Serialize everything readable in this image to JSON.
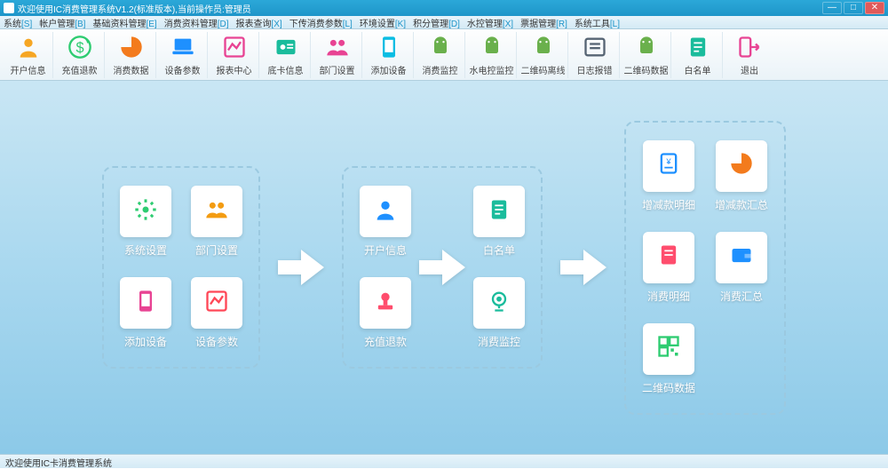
{
  "titlebar": {
    "title": "欢迎使用IC消费管理系统V1.2(标准版本),当前操作员:管理员"
  },
  "menus": [
    {
      "key": "S",
      "label": "系统"
    },
    {
      "key": "B",
      "label": "帐户管理"
    },
    {
      "key": "E",
      "label": "基础资料管理"
    },
    {
      "key": "D",
      "label": "消费资料管理"
    },
    {
      "key": "X",
      "label": "报表查询"
    },
    {
      "key": "L",
      "label": "下传消费参数"
    },
    {
      "key": "K",
      "label": "环境设置"
    },
    {
      "key": "D",
      "label": "积分管理"
    },
    {
      "key": "X",
      "label": "水控管理"
    },
    {
      "key": "R",
      "label": "票据管理"
    },
    {
      "key": "L",
      "label": "系统工具"
    }
  ],
  "toolbar": [
    {
      "name": "open-account-btn",
      "label": "开户信息",
      "color": "#f6a623",
      "icon": "user"
    },
    {
      "name": "recharge-btn",
      "label": "充值退款",
      "color": "#2ecc71",
      "icon": "dollar"
    },
    {
      "name": "consume-btn",
      "label": "消费数据",
      "color": "#f37b1d",
      "icon": "pie"
    },
    {
      "name": "device-param-btn",
      "label": "设备参数",
      "color": "#1e90ff",
      "icon": "laptop"
    },
    {
      "name": "report-btn",
      "label": "报表中心",
      "color": "#e84393",
      "icon": "chart"
    },
    {
      "name": "card-btn",
      "label": "底卡信息",
      "color": "#1abc9c",
      "icon": "id"
    },
    {
      "name": "dept-btn",
      "label": "部门设置",
      "color": "#e84393",
      "icon": "users"
    },
    {
      "name": "add-device-btn",
      "label": "添加设备",
      "color": "#0abde3",
      "icon": "device"
    },
    {
      "name": "consume-monitor-btn",
      "label": "消费监控",
      "color": "#6ab04c",
      "icon": "android"
    },
    {
      "name": "hydro-btn",
      "label": "水电控监控",
      "color": "#6ab04c",
      "icon": "android"
    },
    {
      "name": "qr-btn",
      "label": "二维码离线",
      "color": "#6ab04c",
      "icon": "android"
    },
    {
      "name": "log-btn",
      "label": "日志报错",
      "color": "#576574",
      "icon": "list"
    },
    {
      "name": "qr-data-btn",
      "label": "二维码数据",
      "color": "#6ab04c",
      "icon": "android"
    },
    {
      "name": "whitelist-btn",
      "label": "白名单",
      "color": "#1abc9c",
      "icon": "doc"
    },
    {
      "name": "exit-btn",
      "label": "退出",
      "color": "#e84393",
      "icon": "exit"
    }
  ],
  "groups": {
    "g1": [
      {
        "name": "sys-settings-card",
        "label": "系统设置",
        "color": "#2ecc71",
        "icon": "gear"
      },
      {
        "name": "dept-settings-card",
        "label": "部门设置",
        "color": "#f39c12",
        "icon": "users"
      },
      {
        "name": "add-device-card",
        "label": "添加设备",
        "color": "#e84393",
        "icon": "device"
      },
      {
        "name": "device-param-card",
        "label": "设备参数",
        "color": "#ff4757",
        "icon": "chart"
      }
    ],
    "g2": [
      {
        "name": "open-account-card",
        "label": "开户信息",
        "color": "#1e90ff",
        "icon": "user"
      },
      {
        "name": "whitelist-card",
        "label": "白名单",
        "color": "#1abc9c",
        "icon": "doc"
      },
      {
        "name": "recharge-card",
        "label": "充值退款",
        "color": "#ff4d6d",
        "icon": "stamp"
      },
      {
        "name": "monitor-card",
        "label": "消费监控",
        "color": "#1abc9c",
        "icon": "cam"
      }
    ],
    "g3": [
      {
        "name": "inc-detail-card",
        "label": "增减款明细",
        "color": "#1e90ff",
        "icon": "receipt"
      },
      {
        "name": "inc-summary-card",
        "label": "增减款汇总",
        "color": "#f37b1d",
        "icon": "pie"
      },
      {
        "name": "consume-detail-card",
        "label": "消费明细",
        "color": "#ff4d6d",
        "icon": "receipt2"
      },
      {
        "name": "consume-summary-card",
        "label": "消费汇总",
        "color": "#1e90ff",
        "icon": "wallet"
      },
      {
        "name": "qr-data-card",
        "label": "二维码数据",
        "color": "#2ecc71",
        "icon": "qr"
      }
    ]
  },
  "statusbar": {
    "text": "欢迎使用IC卡消费管理系统"
  }
}
